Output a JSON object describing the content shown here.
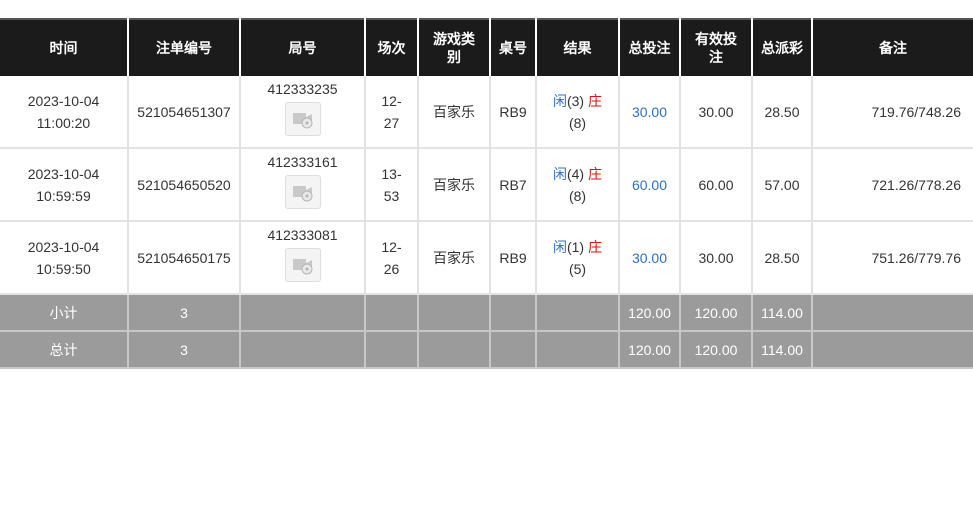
{
  "headers": {
    "time": "时间",
    "bet_no": "注单编号",
    "round": "局号",
    "session": "场次",
    "game_type": "游戏类别",
    "table_no": "桌号",
    "result": "结果",
    "total_bet": "总投注",
    "valid_bet": "有效投注",
    "payout": "总派彩",
    "remark": "备注"
  },
  "rows": [
    {
      "date": "2023-10-04",
      "time": "11:00:20",
      "bet_no": "521054651307",
      "round": "412333235",
      "session_a": "12-",
      "session_b": "27",
      "game_type": "百家乐",
      "table_no": "RB9",
      "player_label": "闲",
      "player_score": "(3)",
      "banker_label": "庄",
      "banker_score": "(8)",
      "total_bet": "30.00",
      "valid_bet": "30.00",
      "payout": "28.50",
      "remark": "719.76/748.26"
    },
    {
      "date": "2023-10-04",
      "time": "10:59:59",
      "bet_no": "521054650520",
      "round": "412333161",
      "session_a": "13-",
      "session_b": "53",
      "game_type": "百家乐",
      "table_no": "RB7",
      "player_label": "闲",
      "player_score": "(4)",
      "banker_label": "庄",
      "banker_score": "(8)",
      "total_bet": "60.00",
      "valid_bet": "60.00",
      "payout": "57.00",
      "remark": "721.26/778.26"
    },
    {
      "date": "2023-10-04",
      "time": "10:59:50",
      "bet_no": "521054650175",
      "round": "412333081",
      "session_a": "12-",
      "session_b": "26",
      "game_type": "百家乐",
      "table_no": "RB9",
      "player_label": "闲",
      "player_score": "(1)",
      "banker_label": "庄",
      "banker_score": "(5)",
      "total_bet": "30.00",
      "valid_bet": "30.00",
      "payout": "28.50",
      "remark": "751.26/779.76"
    }
  ],
  "subtotal": {
    "label": "小计",
    "count": "3",
    "total_bet": "120.00",
    "valid_bet": "120.00",
    "payout": "114.00"
  },
  "grand_total": {
    "label": "总计",
    "count": "3",
    "total_bet": "120.00",
    "valid_bet": "120.00",
    "payout": "114.00"
  },
  "icons": {
    "replay": "video-replay-icon"
  },
  "colors": {
    "header_bg": "#1b1b1b",
    "totals_bg": "#9b9b9b",
    "link_blue": "#2e6fc7",
    "banker_red": "#dd1111"
  }
}
